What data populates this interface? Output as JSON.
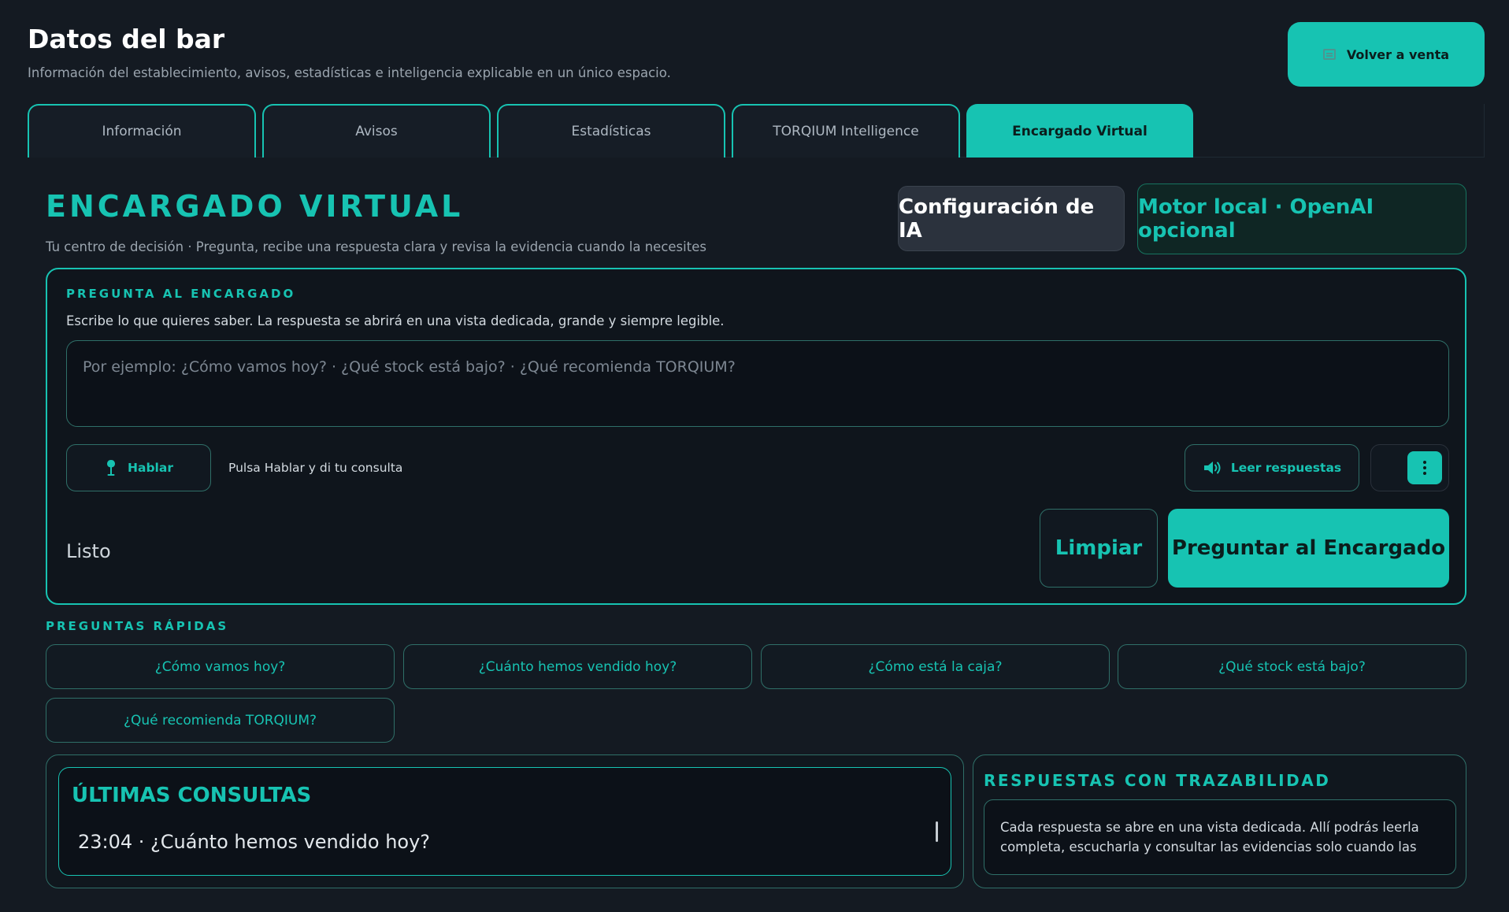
{
  "header": {
    "title": "Datos del bar",
    "subtitle": "Información del establecimiento, avisos, estadísticas e inteligencia explicable en un único espacio.",
    "back_button": {
      "icon": "cash-register-icon",
      "label": "Volver a venta"
    }
  },
  "tabs": [
    {
      "label": "Información",
      "active": false
    },
    {
      "label": "Avisos",
      "active": false
    },
    {
      "label": "Estadísticas",
      "active": false
    },
    {
      "label": "TORQIUM Intelligence",
      "active": false
    },
    {
      "label": "Encargado Virtual",
      "active": true
    }
  ],
  "virtual": {
    "title": "ENCARGADO VIRTUAL",
    "subtitle": "Tu centro de decisión · Pregunta, recibe una respuesta clara y revisa la evidencia cuando la necesites",
    "config_button": "Configuración de IA",
    "engine_badge": "Motor local · OpenAI opcional"
  },
  "ask": {
    "label": "PREGUNTA AL ENCARGADO",
    "hint": "Escribe lo que quieres saber. La respuesta se abrirá en una vista dedicada, grande y siempre legible.",
    "input_value": "",
    "input_placeholder": "Por ejemplo: ¿Cómo vamos hoy? · ¿Qué stock está bajo? · ¿Qué recomienda TORQIUM?",
    "speak_button": "Hablar",
    "speak_hint": "Pulsa Hablar y di tu consulta",
    "read_button": "Leer respuestas",
    "status": "Listo",
    "clear_button": "Limpiar",
    "ask_button": "Preguntar al Encargado"
  },
  "quick": {
    "label": "PREGUNTAS RÁPIDAS",
    "items": [
      "¿Cómo vamos hoy?",
      "¿Cuánto hemos vendido hoy?",
      "¿Cómo está la caja?",
      "¿Qué stock está bajo?",
      "¿Qué recomienda TORQIUM?"
    ]
  },
  "recent": {
    "title": "ÚLTIMAS CONSULTAS",
    "items": [
      "23:04 · ¿Cuánto hemos vendido hoy?"
    ]
  },
  "trace": {
    "title": "RESPUESTAS CON TRAZABILIDAD",
    "text": "Cada respuesta se abre en una vista dedicada. Allí podrás leerla completa, escucharla y consultar las evidencias solo cuando las"
  },
  "colors": {
    "accent": "#17c3b2",
    "background": "#141a22",
    "panel": "#0f151c"
  }
}
